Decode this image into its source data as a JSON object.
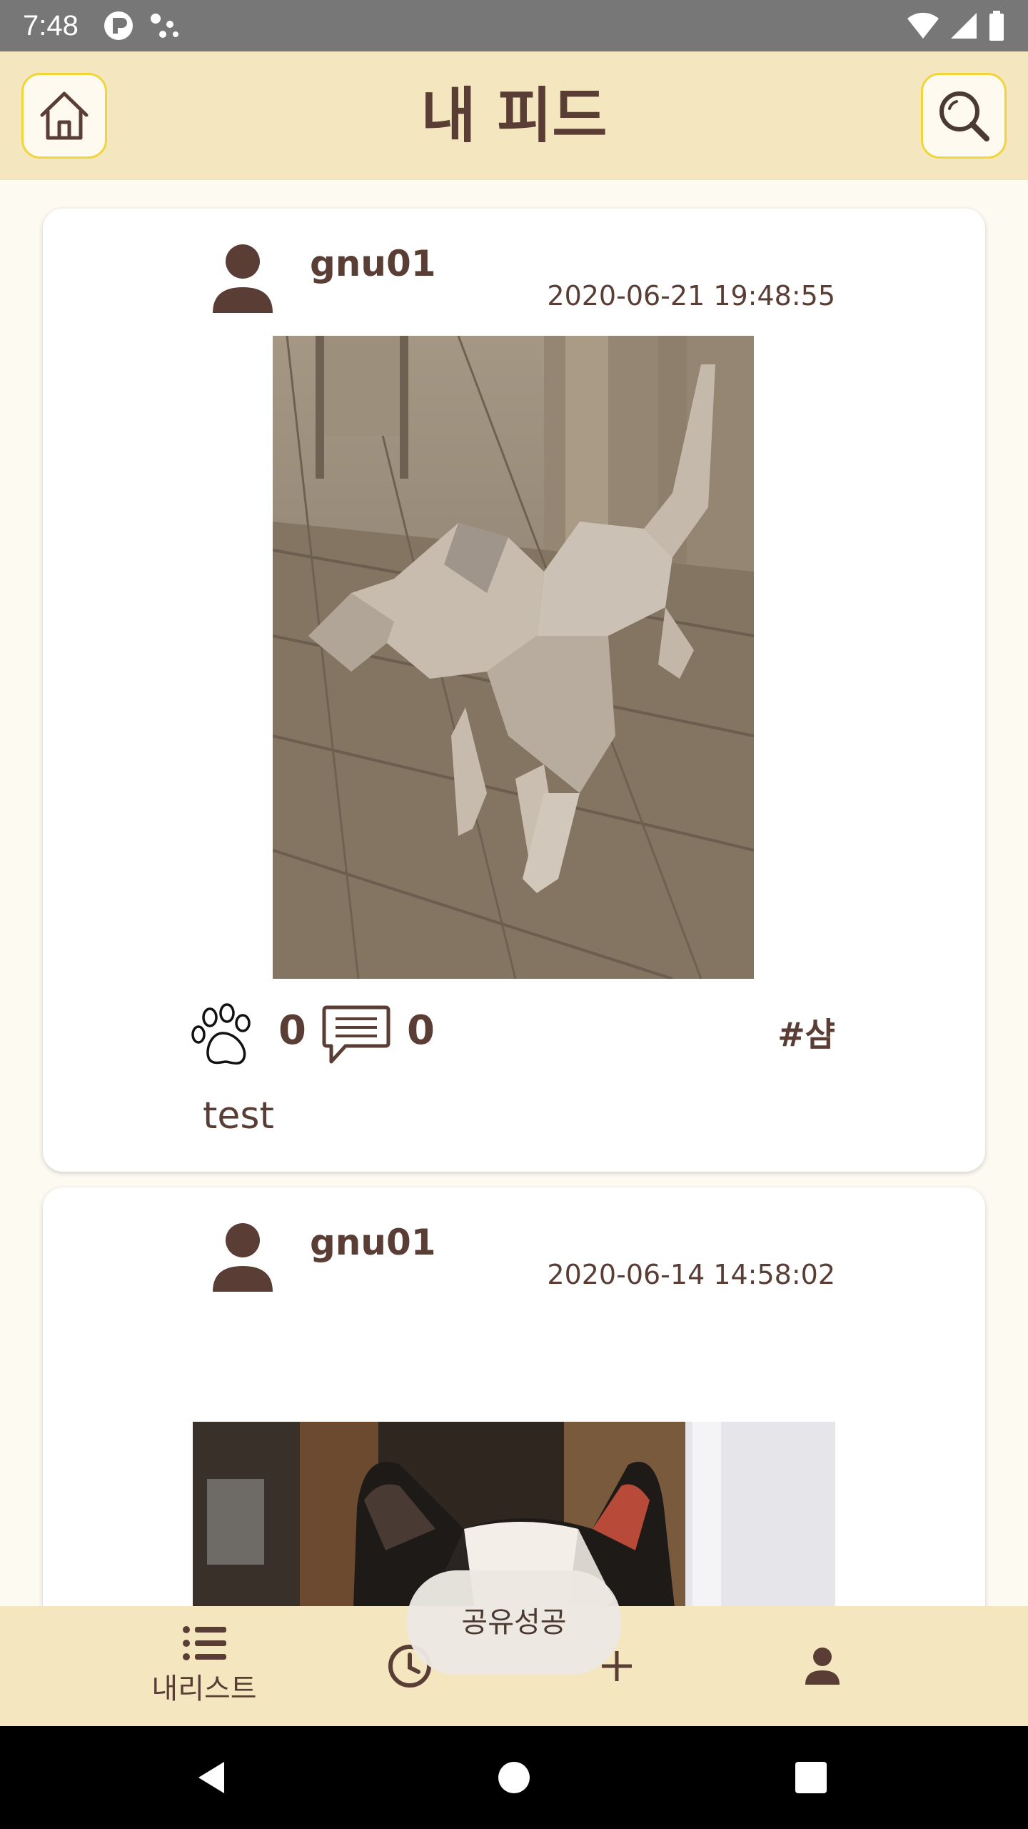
{
  "status_bar": {
    "time": "7:48"
  },
  "app_bar": {
    "title": "내 피드",
    "home_icon": "home-icon",
    "search_icon": "search-icon"
  },
  "posts": [
    {
      "username": "gnu01",
      "timestamp": "2020-06-21 19:48:55",
      "like_count": "0",
      "comment_count": "0",
      "hashtag": "#샴",
      "caption": "test",
      "image": "dog-photo"
    },
    {
      "username": "gnu01",
      "timestamp": "2020-06-14 14:58:02",
      "image": "cat-photo"
    }
  ],
  "toast": {
    "text": "공유성공"
  },
  "bottom_nav": {
    "items": [
      {
        "icon": "list-icon",
        "label": "내리스트"
      },
      {
        "icon": "clock-icon",
        "label": ""
      },
      {
        "icon": "plus-icon",
        "label": ""
      },
      {
        "icon": "person-icon",
        "label": ""
      }
    ]
  },
  "colors": {
    "accent": "#f4e7c0",
    "text": "#5a3e36",
    "button_border": "#f0d53a",
    "background": "#fdfaf2"
  }
}
